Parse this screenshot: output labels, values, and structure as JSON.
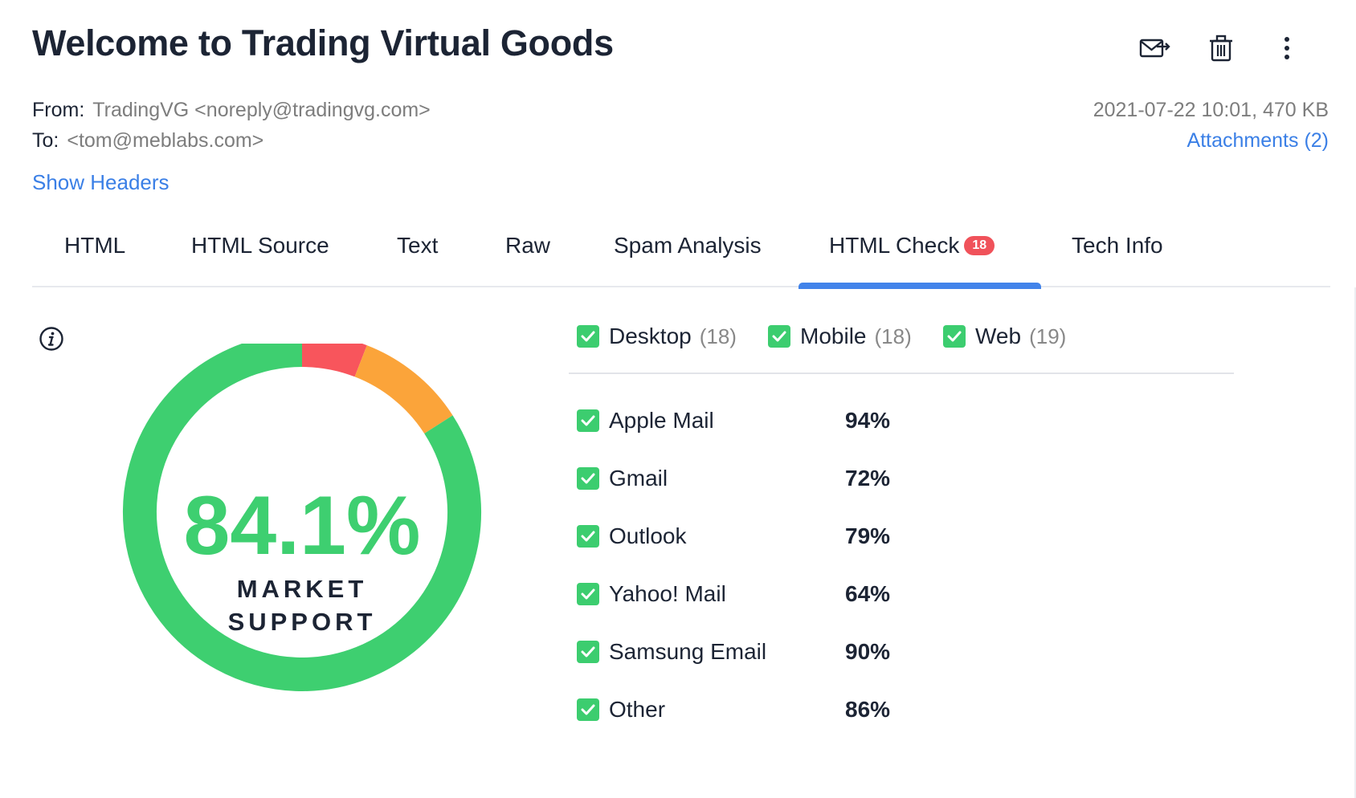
{
  "email": {
    "subject": "Welcome to Trading Virtual Goods",
    "from_label": "From:",
    "from_value": "TradingVG <noreply@tradingvg.com>",
    "to_label": "To:",
    "to_value": "<tom@meblabs.com>",
    "date_size": "2021-07-22 10:01, 470 KB",
    "attachments": "Attachments (2)",
    "show_headers": "Show Headers"
  },
  "toolbar": {
    "icons": [
      "forward-icon",
      "trash-icon",
      "more-vertical-icon"
    ]
  },
  "tabs": [
    {
      "label": "HTML"
    },
    {
      "label": "HTML Source"
    },
    {
      "label": "Text"
    },
    {
      "label": "Raw"
    },
    {
      "label": "Spam Analysis"
    },
    {
      "label": "HTML Check",
      "badge": "18",
      "active": true
    },
    {
      "label": "Tech Info"
    }
  ],
  "html_check": {
    "market_support_value": "84.1%",
    "market_support_label_1": "MARKET",
    "market_support_label_2": "SUPPORT",
    "donut_segments": [
      {
        "label": "supported",
        "fraction": 0.841,
        "color": "#3ecf70"
      },
      {
        "label": "partial",
        "fraction": 0.1,
        "color": "#fba43a"
      },
      {
        "label": "unsupported",
        "fraction": 0.059,
        "color": "#f8555c"
      }
    ],
    "filters": [
      {
        "label": "Desktop",
        "count": "(18)",
        "checked": true
      },
      {
        "label": "Mobile",
        "count": "(18)",
        "checked": true
      },
      {
        "label": "Web",
        "count": "(19)",
        "checked": true
      }
    ],
    "clients": [
      {
        "name": "Apple Mail",
        "percent": "94%",
        "checked": true
      },
      {
        "name": "Gmail",
        "percent": "72%",
        "checked": true
      },
      {
        "name": "Outlook",
        "percent": "79%",
        "checked": true
      },
      {
        "name": "Yahoo! Mail",
        "percent": "64%",
        "checked": true
      },
      {
        "name": "Samsung Email",
        "percent": "90%",
        "checked": true
      },
      {
        "name": "Other",
        "percent": "86%",
        "checked": true
      }
    ]
  },
  "colors": {
    "accent": "#4183ea",
    "link": "#3a7fe6",
    "check": "#3ccd6f",
    "badge": "#f0525a"
  }
}
